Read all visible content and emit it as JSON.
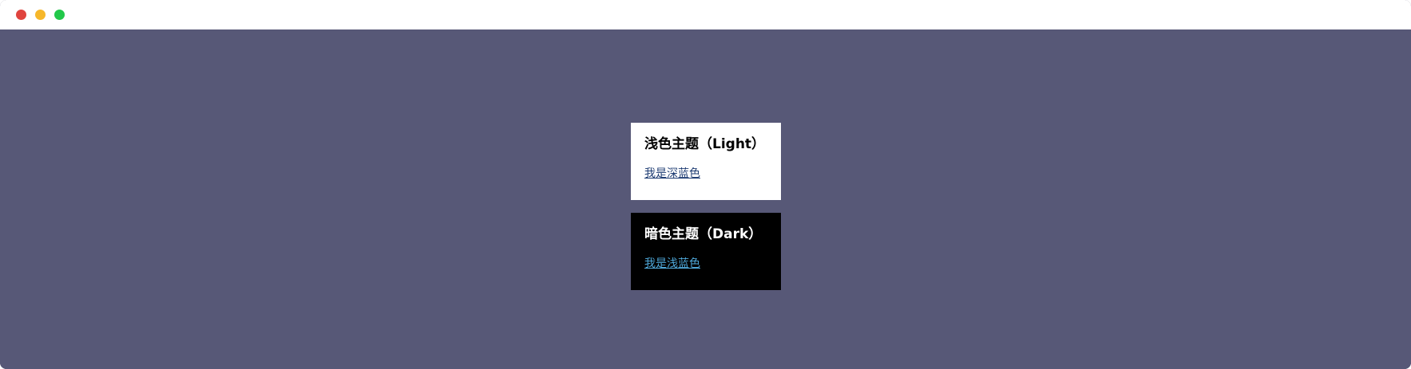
{
  "window": {
    "controls": [
      {
        "name": "close",
        "color": "#e0443e"
      },
      {
        "name": "minimize",
        "color": "#f6b72a"
      },
      {
        "name": "maximize",
        "color": "#22c84a"
      }
    ],
    "background": "#575877"
  },
  "themes": {
    "light": {
      "title": "浅色主题（Light）",
      "link": "我是深蓝色",
      "background": "#ffffff",
      "link_color": "#1f3d73"
    },
    "dark": {
      "title": "暗色主题（Dark）",
      "link": "我是浅蓝色",
      "background": "#000000",
      "link_color": "#4ea7d8"
    }
  }
}
